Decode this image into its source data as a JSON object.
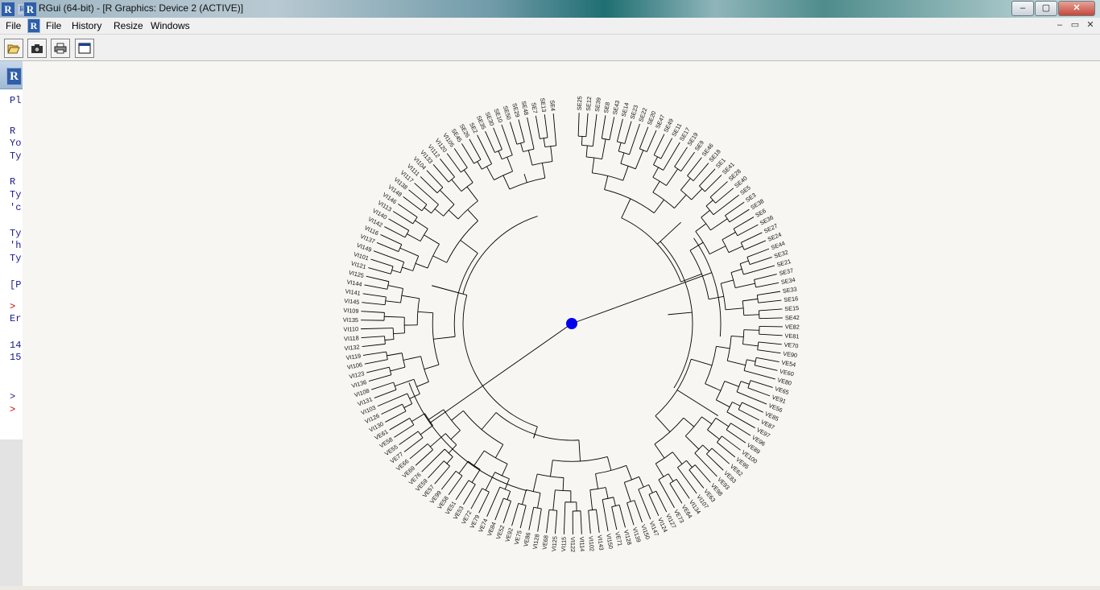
{
  "window": {
    "title": "RGui (64-bit) - [R Graphics: Device 2 (ACTIVE)]",
    "controls": [
      "–",
      "▢",
      "✕"
    ]
  },
  "menubar": {
    "items": [
      "File",
      "File",
      "History",
      "Resize",
      "Windows"
    ],
    "mdi_controls": [
      "–",
      "▭",
      "✕"
    ]
  },
  "toolbar": {
    "buttons": [
      "open-icon",
      "camera-icon",
      "print-icon",
      "window-icon"
    ]
  },
  "console": {
    "lines": [
      "Pl",
      "R",
      "Yo",
      "Ty",
      "R",
      "Ty",
      "'c",
      "Ty",
      "'h",
      "Ty",
      "[P",
      ">",
      "Er",
      "14",
      "15",
      ">",
      ">"
    ]
  },
  "colors": {
    "accent": "#0000ee",
    "line": "#000000",
    "prompt": "#cc0000"
  },
  "dendrogram": {
    "root_marker": "blue-dot",
    "labels": [
      "SE25",
      "SE12",
      "SE39",
      "SE8",
      "SE43",
      "SE14",
      "SE23",
      "SE22",
      "SE20",
      "SE47",
      "SE49",
      "SE11",
      "SE17",
      "SE19",
      "SE9",
      "SE46",
      "SE18",
      "SE1",
      "SE41",
      "SE28",
      "SE40",
      "SE5",
      "SE3",
      "SE38",
      "SE6",
      "SE36",
      "SE27",
      "SE24",
      "SE44",
      "SE32",
      "SE21",
      "SE37",
      "SE34",
      "SE33",
      "SE16",
      "SE15",
      "SE42",
      "VE82",
      "VE81",
      "VE70",
      "VE90",
      "VE54",
      "VE60",
      "VE80",
      "VE65",
      "VE91",
      "VE56",
      "VE85",
      "VE87",
      "VE97",
      "VE96",
      "VE89",
      "VE100",
      "VE95",
      "VE62",
      "VE83",
      "VE93",
      "VE98",
      "VE63",
      "VI107",
      "VI134",
      "VE64",
      "VE73",
      "VI127",
      "VI124",
      "VI147",
      "VI150",
      "VI139",
      "VI128",
      "VE71",
      "VI150",
      "VI143",
      "VI102",
      "VI114",
      "VI122",
      "VI115",
      "VI125",
      "VE68",
      "VI128",
      "VE86",
      "VE75",
      "VE92",
      "VE52",
      "VE84",
      "VE74",
      "VE79",
      "VE72",
      "VE53",
      "VE51",
      "VE58",
      "VE99",
      "VE57",
      "VE59",
      "VE76",
      "VE69",
      "VE66",
      "VE77",
      "VE55",
      "VE58",
      "VE61",
      "VI130",
      "VI126",
      "VI103",
      "VI131",
      "VI108",
      "VI136",
      "VI123",
      "VI106",
      "VI119",
      "VI132",
      "VI118",
      "VI110",
      "VI135",
      "VI109",
      "VI145",
      "VI141",
      "VI144",
      "VI125",
      "VI121",
      "VI101",
      "VI149",
      "VI137",
      "VI116",
      "VI142",
      "VI140",
      "VI113",
      "VI146",
      "VI148",
      "VI138",
      "VI117",
      "VI111",
      "VI104",
      "VI133",
      "VI112",
      "VI120",
      "VI105",
      "SE45",
      "SE26",
      "SE2",
      "SE35",
      "SE30",
      "SE10",
      "SE50",
      "SE29",
      "SE48",
      "SE7",
      "SE13",
      "SE4"
    ]
  }
}
